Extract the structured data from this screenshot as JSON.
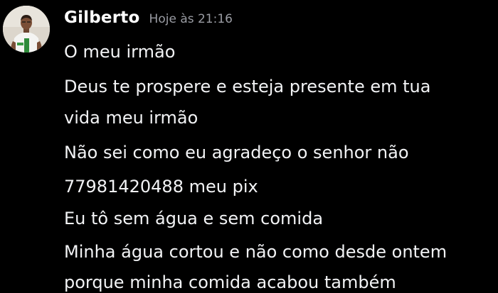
{
  "message": {
    "author": "Gilberto",
    "timestamp": "Hoje às 21:16",
    "avatar_icon": "user-avatar-photo",
    "lines": [
      "O meu irmão",
      "Deus te prospere e esteja presente em tua",
      "vida meu irmão",
      "Não sei como eu agradeço o senhor não",
      "77981420488 meu pix",
      "Eu tô sem água e sem comida",
      "Minha água cortou e não como desde ontem",
      "porque minha comida acabou também"
    ]
  },
  "colors": {
    "background": "#000000",
    "author": "#ffffff",
    "timestamp": "#9a9ca3",
    "text": "#f2f3f5"
  }
}
